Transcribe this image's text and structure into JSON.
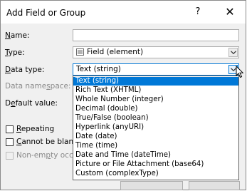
{
  "dialog": {
    "title": "Add Field or Group",
    "help_label": "?",
    "close_label": "✕"
  },
  "form": {
    "name_label": "Name:",
    "name_value": "",
    "type_label": "Type:",
    "type_value": "Field (element)",
    "data_type_label": "Data type:",
    "data_type_value": "Text (string)",
    "data_namespace_label": "Data namespace:",
    "default_value_label": "Default value:",
    "repeating_label": "Repeating",
    "repeating_checked": false,
    "cannot_be_blank_label": "Cannot be blan",
    "cannot_be_blank_checked": false,
    "non_empty_label": "Non-empty occu",
    "non_empty_checked": false
  },
  "dropdown": {
    "items": [
      "Text (string)",
      "Rich Text (XHTML)",
      "Whole Number (integer)",
      "Decimal (double)",
      "True/False (boolean)",
      "Hyperlink (anyURI)",
      "Date (date)",
      "Time (time)",
      "Date and Time (dateTime)",
      "Picture or File Attachment (base64)",
      "Custom (complexType)"
    ],
    "selected_index": 0
  },
  "colors": {
    "selection": "#0078d7",
    "dialog_bg": "#f0f0f0",
    "titlebar_bg": "#ffffff"
  },
  "icons": {
    "type_icon": "field-element-icon",
    "combo_arrow": "chevron-down-icon",
    "close": "close-icon",
    "help": "help-icon",
    "pointer": "mouse-pointer-icon"
  }
}
